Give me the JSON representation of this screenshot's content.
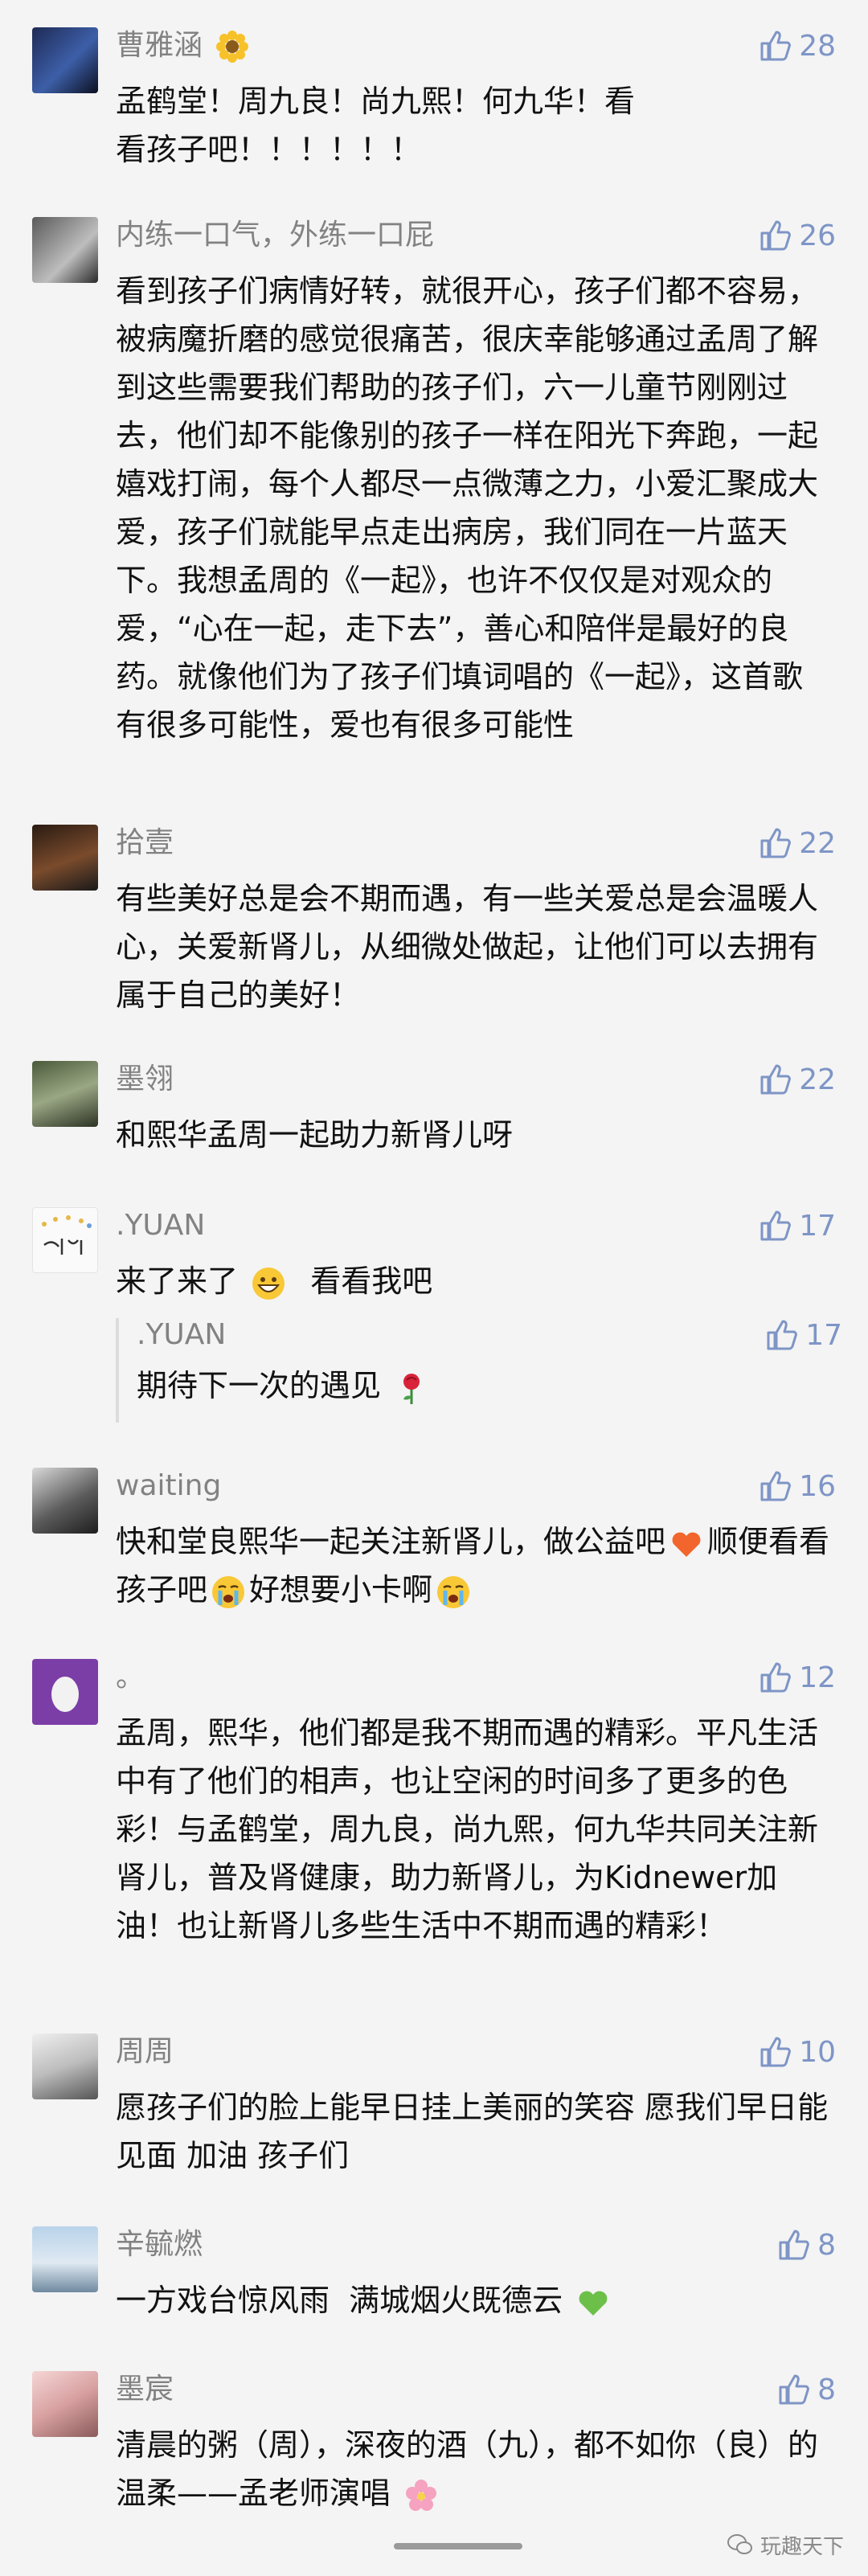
{
  "comments": [
    {
      "name": "曹雅涵",
      "likes": "28",
      "text": "孟鹤堂！周九良！尚九熙！何九华！看看孩子吧！！！！！！"
    },
    {
      "name": "内练一口气，外练一口屁",
      "likes": "26",
      "text": "看到孩子们病情好转，就很开心，孩子们都不容易，被病魔折磨的感觉很痛苦，很庆幸能够通过孟周了解到这些需要我们帮助的孩子们，六一儿童节刚刚过去，他们却不能像别的孩子一样在阳光下奔跑，一起嬉戏打闹，每个人都尽一点微薄之力，小爱汇聚成大爱，孩子们就能早点走出病房，我们同在一片蓝天下。我想孟周的《一起》，也许不仅仅是对观众的爱，“心在一起，走下去”，善心和陪伴是最好的良药。就像他们为了孩子们填词唱的《一起》，这首歌有很多可能性，爱也有很多可能性"
    },
    {
      "name": "拾壹",
      "likes": "22",
      "text": "有些美好总是会不期而遇，有一些关爱总是会温暖人心，关爱新肾儿，从细微处做起，让他们可以去拥有属于自己的美好！"
    },
    {
      "name": "墨翎",
      "likes": "22",
      "text": "和熙华孟周一起助力新肾儿呀"
    },
    {
      "name": ".YUAN",
      "likes": "17",
      "text": "来了来了",
      "text_after": "看看我吧",
      "reply": {
        "name": ".YUAN",
        "likes": "17",
        "text": "期待下一次的遇见"
      }
    },
    {
      "name": "waiting",
      "likes": "16",
      "text_parts": [
        "快和堂良熙华一起关注新肾儿，做公益吧",
        "顺便看看孩子吧",
        "好想要小卡啊"
      ]
    },
    {
      "name": "。",
      "likes": "12",
      "text": "孟周，熙华，他们都是我不期而遇的精彩。平凡生活中有了他们的相声，也让空闲的时间多了更多的色彩！与孟鹤堂，周九良，尚九熙，何九华共同关注新肾儿，普及肾健康，助力新肾儿，为Kidnewer加油！也让新肾儿多些生活中不期而遇的精彩！"
    },
    {
      "name": "周周",
      "likes": "10",
      "text": "愿孩子们的脸上能早日挂上美丽的笑容 愿我们早日能见面 加油 孩子们"
    },
    {
      "name": "辛毓燃",
      "likes": "8",
      "text": "一方戏台惊风雨  满城烟火既德云"
    },
    {
      "name": "墨宸",
      "likes": "8",
      "text": "清晨的粥（周），深夜的酒（九），都不如你（良）的温柔——孟老师演唱"
    }
  ],
  "watermark": "玩趣天下",
  "colors": {
    "accent": "#7e95c6",
    "name": "#828282",
    "text": "#111111",
    "background": "#f4f4f4"
  }
}
